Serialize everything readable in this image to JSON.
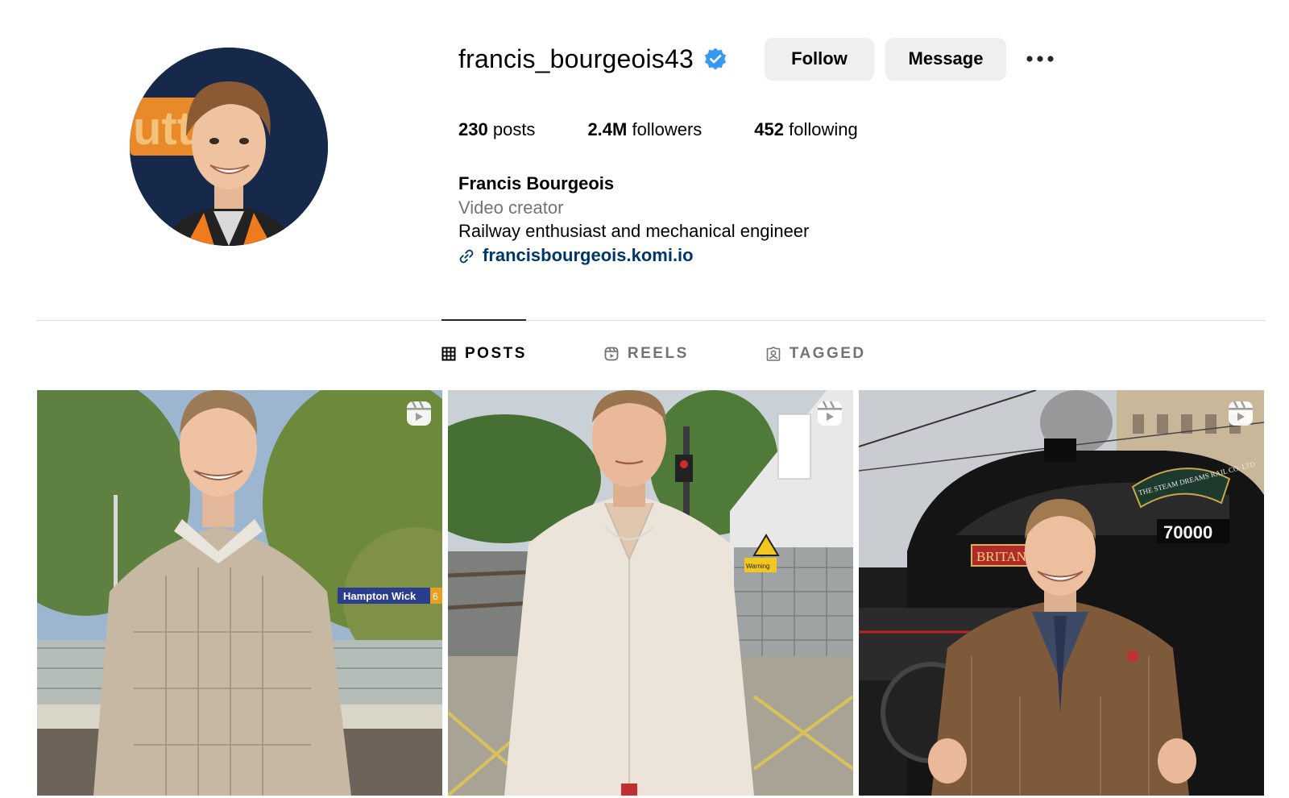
{
  "profile": {
    "username": "francis_bourgeois43",
    "verified": true,
    "follow_label": "Follow",
    "message_label": "Message",
    "more_icon": "more-options-icon"
  },
  "stats": {
    "posts_count": "230",
    "posts_label": "posts",
    "followers_count": "2.4M",
    "followers_label": "followers",
    "following_count": "452",
    "following_label": "following"
  },
  "bio": {
    "name": "Francis Bourgeois",
    "category": "Video creator",
    "description": "Railway enthusiast and mechanical engineer",
    "link": "francisbourgeois.komi.io"
  },
  "tabs": [
    {
      "label": "POSTS",
      "icon": "grid-icon",
      "active": true
    },
    {
      "label": "REELS",
      "icon": "reels-icon",
      "active": false
    },
    {
      "label": "TAGGED",
      "icon": "tagged-icon",
      "active": false
    }
  ],
  "posts": [
    {
      "type": "reel",
      "icon": "reel-badge-icon",
      "sign_text": "Hampton Wick",
      "sign_number": "6"
    },
    {
      "type": "reel",
      "icon": "reel-badge-icon",
      "warning_text": "Warning"
    },
    {
      "type": "reel",
      "icon": "reel-badge-icon",
      "loco_plate": "BRITANNIA",
      "loco_number": "70000",
      "headboard": "THE STEAM DREAMS RAIL CO. LTD"
    }
  ],
  "colors": {
    "link": "#00376b",
    "verified": "#3897f0",
    "secondary_text": "#737373",
    "button_bg": "#efefef",
    "divider": "#dbdbdb"
  }
}
